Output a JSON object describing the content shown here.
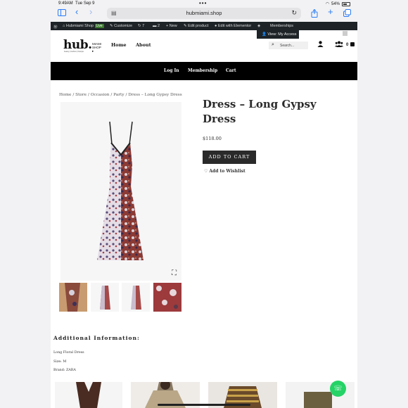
{
  "status": {
    "time": "9:49AM",
    "date": "Tue Sep 9",
    "dots": "•••",
    "battery": "54%"
  },
  "browser": {
    "url": "hubmiami.shop"
  },
  "adminbar": {
    "site": "Hubmiami Shop",
    "live": "Live",
    "customize": "Customize",
    "updates": "7",
    "comments": "2",
    "new": "+ New",
    "edit_product": "Edit product",
    "edit_elementor": "Edit with Elementor",
    "memberships": "Memberships",
    "view_access": "View: My Access"
  },
  "logo": {
    "hub": "hub.",
    "miami": "MIAMI",
    "shop": "SHOP",
    "tagline": "beauty | fashion | lifestyle"
  },
  "nav": {
    "home": "Home",
    "about": "About"
  },
  "search": {
    "placeholder": "Search..."
  },
  "cart": {
    "count": "0"
  },
  "menu": {
    "login": "Log In",
    "membership": "Membership",
    "cart": "Cart"
  },
  "breadcrumb": "Home / Store / Occasion / Party / Dress – Long Gypsy Dress",
  "product": {
    "title": "Dress – Long Gypsy Dress",
    "price": "$118.00",
    "add_to_cart": "ADD TO CART",
    "wishlist": "Add to Wishlist"
  },
  "additional": {
    "heading": "Additional Information:",
    "lines": [
      "Long Floral Dress",
      "Size: M",
      "Brand: ZARA"
    ]
  },
  "icons": {
    "sidebar": "sidebar-icon",
    "back": "chevron-left-icon",
    "forward": "chevron-right-icon",
    "share": "share-icon",
    "new_tab": "plus-icon",
    "tabs": "tabs-icon",
    "reload": "reload-icon",
    "user": "user-icon",
    "group": "group-icon",
    "cart": "cart-icon",
    "search": "search-icon",
    "expand": "expand-icon",
    "heart": "heart-icon",
    "whatsapp": "whatsapp-icon"
  },
  "colors": {
    "accent": "#2a7cf5",
    "adminbar": "#1d2327",
    "menu": "#000000",
    "button": "#2a2a2a",
    "whatsapp": "#25d366"
  }
}
